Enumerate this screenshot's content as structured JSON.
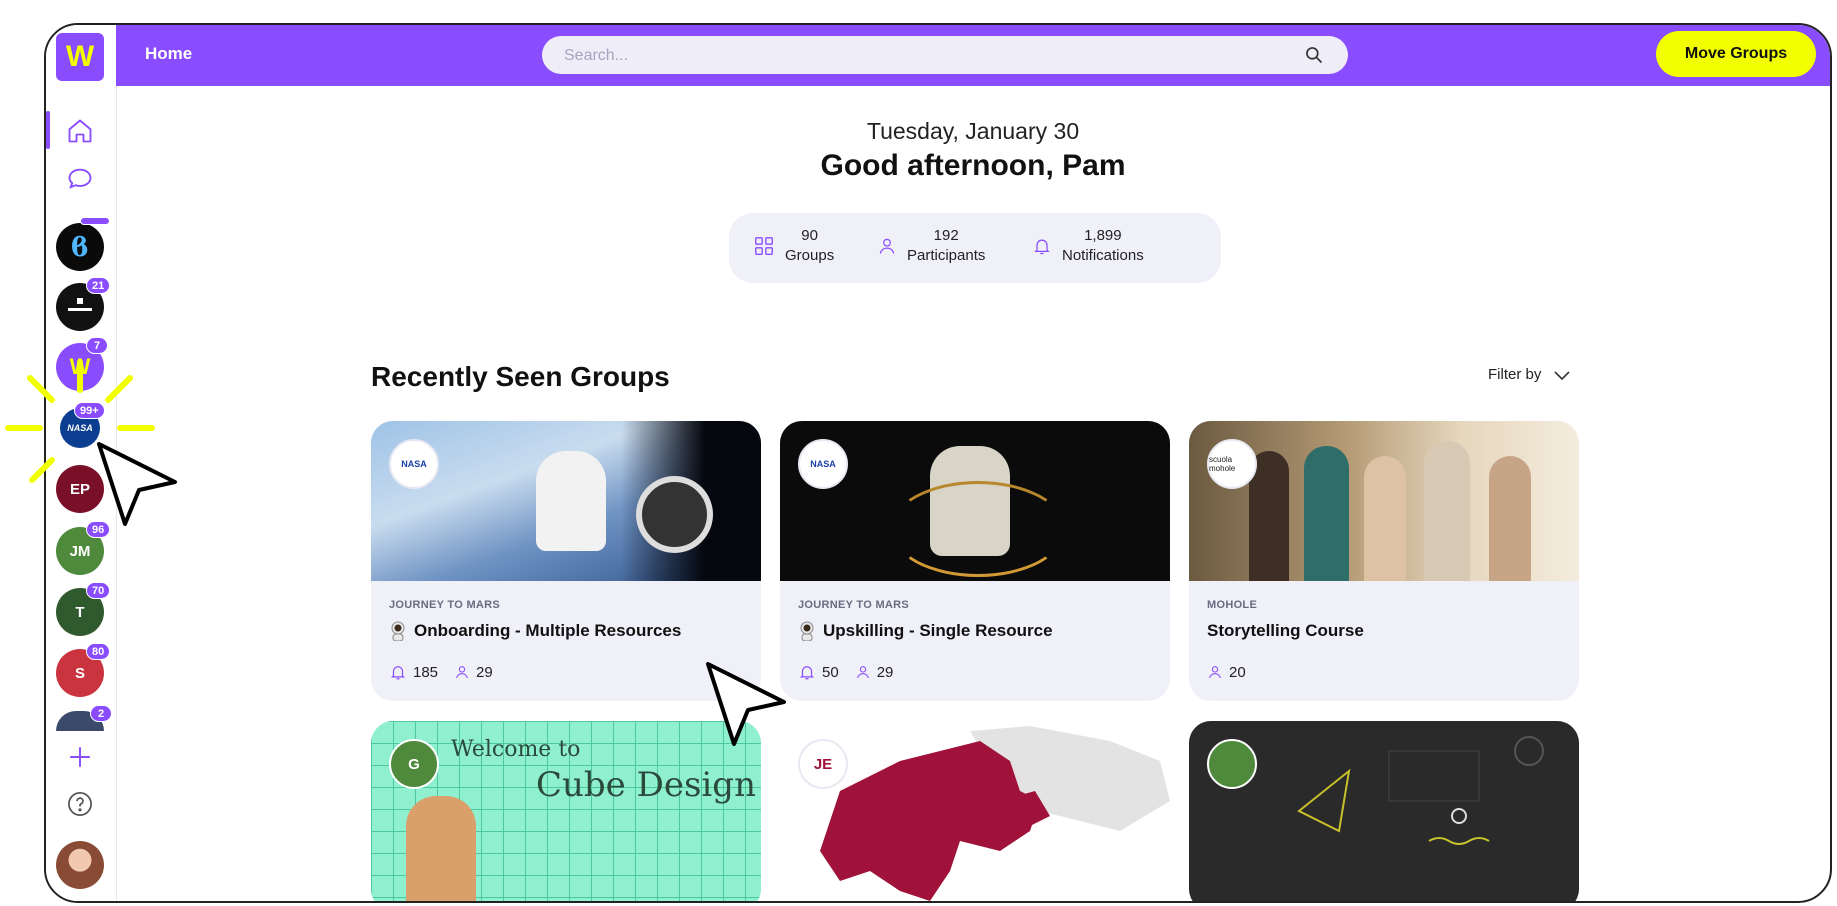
{
  "app": {
    "logo_letter": "W"
  },
  "header": {
    "title": "Home",
    "search_placeholder": "Search...",
    "move_groups_label": "Move Groups"
  },
  "sidebar": {
    "groups": [
      {
        "badge": ""
      },
      {
        "badge": "21"
      },
      {
        "badge": "7"
      },
      {
        "badge": "99+",
        "label": "NASA"
      },
      {
        "initials": "EP",
        "badge": ""
      },
      {
        "initials": "JM",
        "badge": "96"
      },
      {
        "initials": "T",
        "badge": "70"
      },
      {
        "initials": "S",
        "badge": "80"
      },
      {
        "badge": "2"
      }
    ]
  },
  "welcome": {
    "date": "Tuesday, January 30",
    "greeting": "Good afternoon, Pam"
  },
  "stats": {
    "groups_value": "90",
    "groups_label": "Groups",
    "participants_value": "192",
    "participants_label": "Participants",
    "notifications_value": "1,899",
    "notifications_label": "Notifications"
  },
  "recent": {
    "title": "Recently Seen Groups",
    "filter_label": "Filter by",
    "cards": [
      {
        "logo": "NASA",
        "category": "JOURNEY TO MARS",
        "title": "Onboarding - Multiple Resources",
        "notifications": "185",
        "participants": "29"
      },
      {
        "logo": "NASA",
        "category": "JOURNEY TO MARS",
        "title": "Upskilling - Single Resource",
        "notifications": "50",
        "participants": "29"
      },
      {
        "logo": "scuola mohole",
        "category": "MOHOLE",
        "title": "Storytelling Course",
        "participants": "20"
      },
      {
        "logo": "G",
        "banner_line1": "Welcome to",
        "banner_line2": "Cube Design"
      },
      {
        "logo": "JE"
      },
      {
        "logo": ""
      }
    ]
  },
  "colors": {
    "brand": "#8a4cff",
    "accent": "#f2ff00"
  }
}
